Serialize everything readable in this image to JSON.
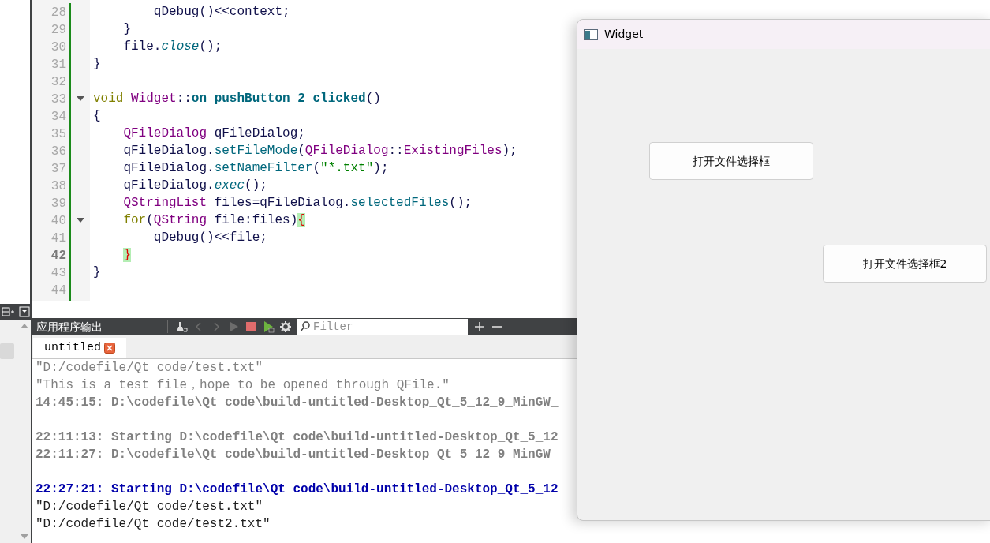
{
  "editor": {
    "lines": [
      {
        "number": "28",
        "current": false,
        "fold": false,
        "tokens": [
          {
            "kind": "plain",
            "text": "        qDebug()<<context;"
          }
        ]
      },
      {
        "number": "29",
        "current": false,
        "fold": false,
        "tokens": [
          {
            "kind": "plain",
            "text": "    }"
          }
        ]
      },
      {
        "number": "30",
        "current": false,
        "fold": false,
        "tokens": [
          {
            "kind": "plain",
            "text": "    file."
          },
          {
            "kind": "virtual",
            "text": "close"
          },
          {
            "kind": "plain",
            "text": "();"
          }
        ]
      },
      {
        "number": "31",
        "current": false,
        "fold": false,
        "tokens": [
          {
            "kind": "plain",
            "text": "}"
          }
        ]
      },
      {
        "number": "32",
        "current": false,
        "fold": false
      },
      {
        "number": "33",
        "current": false,
        "fold": true,
        "tokens": [
          {
            "kind": "keyword",
            "text": "void "
          },
          {
            "kind": "type",
            "text": "Widget"
          },
          {
            "kind": "plain",
            "text": "::"
          },
          {
            "kind": "decl",
            "text": "on_pushButton_2_clicked"
          },
          {
            "kind": "plain",
            "text": "()"
          }
        ]
      },
      {
        "number": "34",
        "current": false,
        "fold": false,
        "tokens": [
          {
            "kind": "plain",
            "text": "{"
          }
        ]
      },
      {
        "number": "35",
        "current": false,
        "fold": false,
        "tokens": [
          {
            "kind": "type",
            "text": "    QFileDialog"
          },
          {
            "kind": "plain",
            "text": " qFileDialog;"
          }
        ]
      },
      {
        "number": "36",
        "current": false,
        "fold": false,
        "tokens": [
          {
            "kind": "plain",
            "text": "    qFileDialog."
          },
          {
            "kind": "func",
            "text": "setFileMode"
          },
          {
            "kind": "plain",
            "text": "("
          },
          {
            "kind": "type",
            "text": "QFileDialog"
          },
          {
            "kind": "plain",
            "text": "::"
          },
          {
            "kind": "enum",
            "text": "ExistingFiles"
          },
          {
            "kind": "plain",
            "text": ");"
          }
        ]
      },
      {
        "number": "37",
        "current": false,
        "fold": false,
        "tokens": [
          {
            "kind": "plain",
            "text": "    qFileDialog."
          },
          {
            "kind": "func",
            "text": "setNameFilter"
          },
          {
            "kind": "plain",
            "text": "("
          },
          {
            "kind": "string",
            "text": "\"*.txt\""
          },
          {
            "kind": "plain",
            "text": ");"
          }
        ]
      },
      {
        "number": "38",
        "current": false,
        "fold": false,
        "tokens": [
          {
            "kind": "plain",
            "text": "    qFileDialog."
          },
          {
            "kind": "virtual",
            "text": "exec"
          },
          {
            "kind": "plain",
            "text": "();"
          }
        ]
      },
      {
        "number": "39",
        "current": false,
        "fold": false,
        "tokens": [
          {
            "kind": "type",
            "text": "    QStringList"
          },
          {
            "kind": "plain",
            "text": " files=qFileDialog."
          },
          {
            "kind": "func",
            "text": "selectedFiles"
          },
          {
            "kind": "plain",
            "text": "();"
          }
        ]
      },
      {
        "number": "40",
        "current": false,
        "fold": true,
        "tokens": [
          {
            "kind": "keyword",
            "text": "    for"
          },
          {
            "kind": "plain",
            "text": "("
          },
          {
            "kind": "type",
            "text": "QString"
          },
          {
            "kind": "plain",
            "text": " file:files)"
          },
          {
            "kind": "brace-match",
            "text": "{"
          }
        ]
      },
      {
        "number": "41",
        "current": false,
        "fold": false,
        "tokens": [
          {
            "kind": "plain",
            "text": "        qDebug()<<file;"
          }
        ]
      },
      {
        "number": "42",
        "current": true,
        "fold": false,
        "tokens": [
          {
            "kind": "brace-match",
            "text": "    }"
          }
        ]
      },
      {
        "number": "43",
        "current": false,
        "fold": false,
        "tokens": [
          {
            "kind": "plain",
            "text": "}"
          }
        ]
      },
      {
        "number": "44",
        "current": false,
        "fold": false
      }
    ]
  },
  "output_pane": {
    "title": "应用程序输出",
    "filter": {
      "placeholder": "Filter"
    },
    "tabs": [
      {
        "label": "untitled",
        "selected": true
      }
    ],
    "lines": [
      {
        "kind": "old-out",
        "text": "\"D:/codefile/Qt code/test.txt\""
      },
      {
        "kind": "old-out",
        "text": "\"This is a test file，hope to be opened through QFile.\""
      },
      {
        "kind": "old-msg",
        "text": "14:45:15: D:\\codefile\\Qt code\\build-untitled-Desktop_Qt_5_12_9_MinGW_"
      },
      {
        "kind": "blank"
      },
      {
        "kind": "old-msg",
        "text": "22:11:13: Starting D:\\codefile\\Qt code\\build-untitled-Desktop_Qt_5_12"
      },
      {
        "kind": "old-msg",
        "text": "22:11:27: D:\\codefile\\Qt code\\build-untitled-Desktop_Qt_5_12_9_MinGW_"
      },
      {
        "kind": "blank"
      },
      {
        "kind": "msg",
        "text": "22:27:21: Starting D:\\codefile\\Qt code\\build-untitled-Desktop_Qt_5_12"
      },
      {
        "kind": "out",
        "text": "\"D:/codefile/Qt code/test.txt\""
      },
      {
        "kind": "out",
        "text": "\"D:/codefile/Qt code/test2.txt\""
      }
    ]
  },
  "widget_window": {
    "title": "Widget",
    "buttons": [
      {
        "label": "打开文件选择框"
      },
      {
        "label": "打开文件选择框2"
      }
    ]
  }
}
